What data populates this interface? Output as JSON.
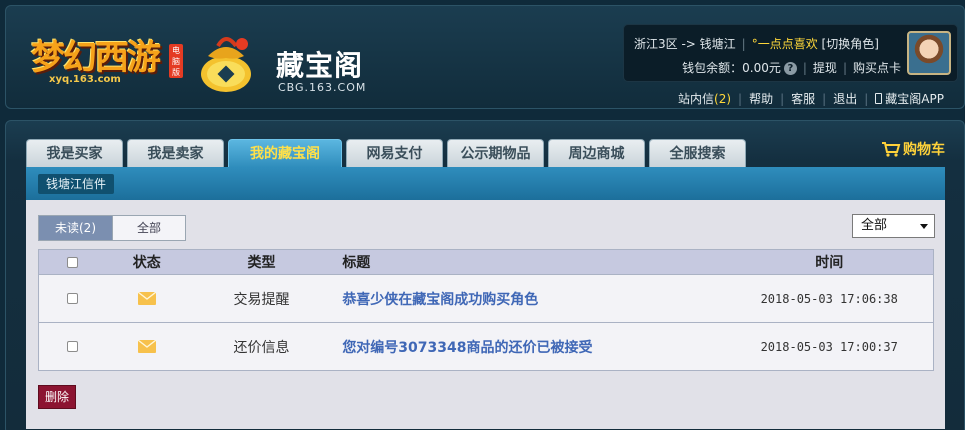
{
  "header": {
    "logo_game": "梦幻西游",
    "logo_game_badge": "电脑版",
    "logo_game_domain": "xyq.163.com",
    "logo_cbg": "藏宝阁",
    "logo_cbg_domain": "CBG.163.COM",
    "server": "浙江3区 -> 钱塘江",
    "nickname": "°一点点喜欢",
    "switch_role": "[切换角色]",
    "wallet_label": "钱包余额：0.00元",
    "withdraw": "提现",
    "buy_card": "购买点卡",
    "nav": {
      "inbox": "站内信",
      "inbox_count": "(2)",
      "help": "帮助",
      "service": "客服",
      "logout": "退出",
      "app": "藏宝阁APP"
    }
  },
  "tabs": [
    "我是买家",
    "我是卖家",
    "我的藏宝阁",
    "网易支付",
    "公示期物品",
    "周边商城",
    "全服搜索"
  ],
  "active_tab_index": 2,
  "cart": "购物车",
  "subtab": "钱塘江信件",
  "filter": {
    "unread": "未读(2)",
    "all": "全部"
  },
  "select": {
    "value": "全部"
  },
  "table": {
    "headers": {
      "state": "状态",
      "type": "类型",
      "title": "标题",
      "time": "时间"
    },
    "rows": [
      {
        "type": "交易提醒",
        "title": "恭喜少侠在藏宝阁成功购买角色",
        "time": "2018-05-03 17:06:38"
      },
      {
        "type": "还价信息",
        "title": "您对编号3073348商品的还价已被接受",
        "time": "2018-05-03 17:00:37"
      }
    ]
  },
  "delete_button": "删除",
  "colors": {
    "accent": "#2e8cbb",
    "active_tab_text": "#ffe04a",
    "link": "#3f67b6",
    "delete": "#8c1431"
  }
}
